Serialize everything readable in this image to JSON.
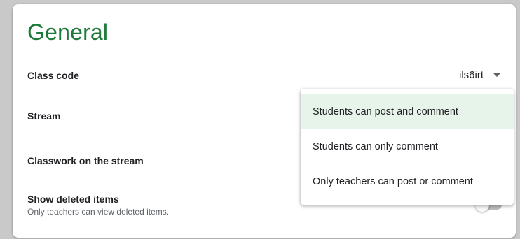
{
  "section": {
    "title": "General"
  },
  "rows": {
    "class_code": {
      "label": "Class code",
      "value": "ils6irt"
    },
    "stream": {
      "label": "Stream"
    },
    "classwork": {
      "label": "Classwork on the stream"
    },
    "deleted": {
      "label": "Show deleted items",
      "description": "Only teachers can view deleted items.",
      "enabled": false
    }
  },
  "stream_menu": {
    "options": [
      {
        "label": "Students can post and comment",
        "selected": true
      },
      {
        "label": "Students can only comment",
        "selected": false
      },
      {
        "label": "Only teachers can post or comment",
        "selected": false
      }
    ]
  },
  "colors": {
    "title": "#1e7a3a",
    "selected_option_bg": "#e6f4ea"
  },
  "icons": {
    "class_code_dropdown": "caret-down-icon"
  }
}
